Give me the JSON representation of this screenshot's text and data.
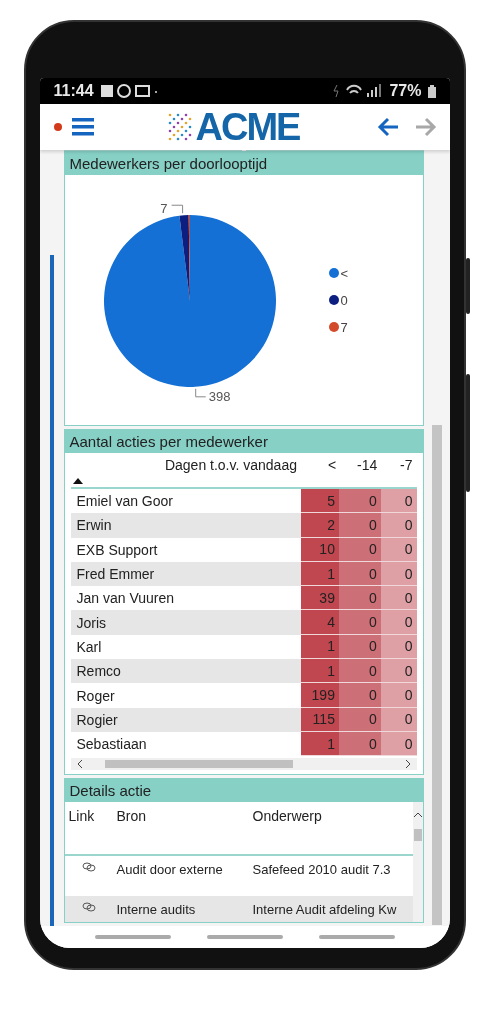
{
  "status_bar": {
    "time": "11:44",
    "battery": "77%"
  },
  "header": {
    "logo": "ACME",
    "nav": [
      {
        "kind": "back",
        "disabled": false
      },
      {
        "kind": "forward",
        "disabled": true
      }
    ]
  },
  "pie_card": {
    "title": "Medewerkers per doorlooptijd",
    "chart_data": {
      "type": "pie",
      "categories": [
        "<",
        "0",
        "7"
      ],
      "values": [
        398,
        7,
        1
      ],
      "value_labels": [
        "398",
        "7",
        null
      ]
    },
    "legend": [
      {
        "color": "#1470d4"
      },
      {
        "color": "#0c1f80"
      },
      {
        "color": "#d24a2a"
      }
    ]
  },
  "actions_card": {
    "title": "Aantal acties per medewerker",
    "columns": [
      "Dagen t.o.v. vandaag",
      "<",
      "-14",
      "-7"
    ],
    "rows": [
      {
        "name": "Emiel van Goor",
        "values": [
          "5",
          "0",
          "0"
        ]
      },
      {
        "name": "Erwin",
        "values": [
          "2",
          "0",
          "0"
        ]
      },
      {
        "name": "EXB Support",
        "values": [
          "10",
          "0",
          "0"
        ]
      },
      {
        "name": "Fred Emmer",
        "values": [
          "1",
          "0",
          "0"
        ]
      },
      {
        "name": "Jan van Vuuren",
        "values": [
          "39",
          "0",
          "0"
        ]
      },
      {
        "name": "Joris",
        "values": [
          "4",
          "0",
          "0"
        ]
      },
      {
        "name": "Karl",
        "values": [
          "1",
          "0",
          "0"
        ]
      },
      {
        "name": "Remco",
        "values": [
          "1",
          "0",
          "0"
        ]
      },
      {
        "name": "Roger",
        "values": [
          "199",
          "0",
          "0"
        ]
      },
      {
        "name": "Rogier",
        "values": [
          "115",
          "0",
          "0"
        ]
      },
      {
        "name": "Sebastiaan",
        "values": [
          "1",
          "0",
          "0"
        ]
      }
    ]
  },
  "details_card": {
    "title": "Details actie",
    "columns": [
      "Link",
      "Bron",
      "Onderwerp"
    ],
    "rows": [
      {
        "bron": "Audit door externe",
        "onderwerp": "Safefeed 2010 audit 7.3"
      },
      {
        "bron": "Interne audits",
        "onderwerp": "Interne Audit afdeling Kw"
      }
    ]
  }
}
